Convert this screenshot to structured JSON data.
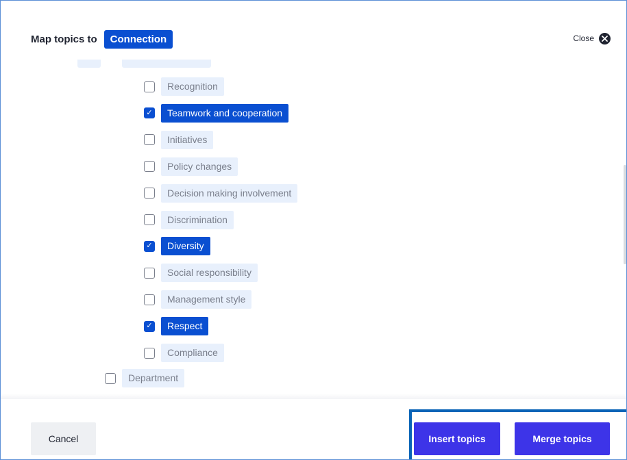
{
  "header": {
    "title": "Map topics to",
    "badge": "Connection"
  },
  "close": {
    "label": "Close",
    "icon": "close-icon"
  },
  "topics": [
    {
      "label": "Recognition",
      "checked": false,
      "level": 2
    },
    {
      "label": "Teamwork and cooperation",
      "checked": true,
      "level": 2
    },
    {
      "label": "Initiatives",
      "checked": false,
      "level": 2
    },
    {
      "label": "Policy changes",
      "checked": false,
      "level": 2
    },
    {
      "label": "Decision making involvement",
      "checked": false,
      "level": 2
    },
    {
      "label": "Discrimination",
      "checked": false,
      "level": 2
    },
    {
      "label": "Diversity",
      "checked": true,
      "level": 2
    },
    {
      "label": "Social responsibility",
      "checked": false,
      "level": 2
    },
    {
      "label": "Management style",
      "checked": false,
      "level": 2
    },
    {
      "label": "Respect",
      "checked": true,
      "level": 2
    },
    {
      "label": "Compliance",
      "checked": false,
      "level": 2
    },
    {
      "label": "Department",
      "checked": false,
      "level": 1
    }
  ],
  "footer": {
    "cancel_label": "Cancel",
    "insert_label": "Insert topics",
    "merge_label": "Merge topics"
  },
  "colors": {
    "accent": "#0a4fd1",
    "primary_button": "#3d34e8",
    "tag_bg": "#e8f0fc",
    "highlight": "#0a64b7"
  }
}
